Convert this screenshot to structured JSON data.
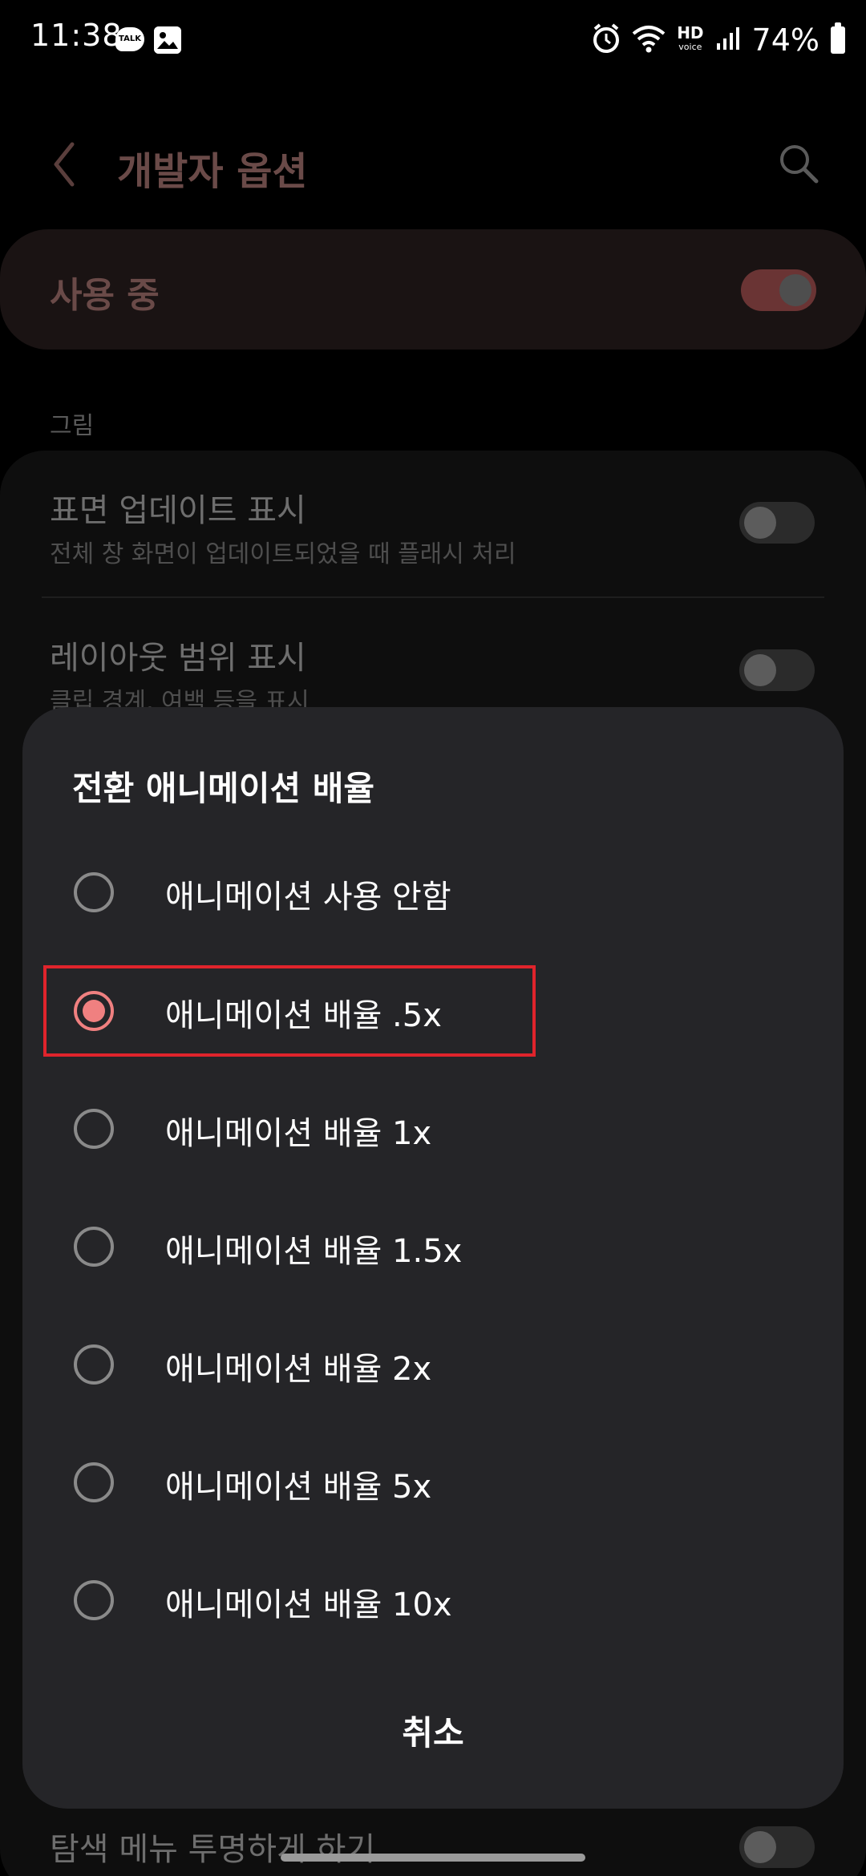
{
  "status_bar": {
    "time": "11:38",
    "talk_badge": "TALK",
    "hd_label": "HD",
    "voice_label": "voice",
    "battery": "74%"
  },
  "header": {
    "title": "개발자 옵션"
  },
  "master_switch": {
    "label": "사용 중",
    "on": true
  },
  "section": {
    "label": "그림"
  },
  "background_items": [
    {
      "title": "표면 업데이트 표시",
      "subtitle": "전체 창 화면이 업데이트되었을 때 플래시 처리"
    },
    {
      "title": "레이아웃 범위 표시",
      "subtitle": "클립 경계, 여백 등을 표시"
    },
    {
      "title": "탐색 메뉴 투명하게 하기"
    }
  ],
  "dialog": {
    "title": "전환 애니메이션 배율",
    "selected_index": 1,
    "options": [
      "애니메이션 사용 안함",
      "애니메이션 배율 .5x",
      "애니메이션 배율 1x",
      "애니메이션 배율 1.5x",
      "애니메이션 배율 2x",
      "애니메이션 배율 5x",
      "애니메이션 배율 10x"
    ],
    "cancel_label": "취소"
  },
  "colors": {
    "accent": "#f08080",
    "highlight": "#e0242c",
    "dialog_bg": "#252528"
  }
}
